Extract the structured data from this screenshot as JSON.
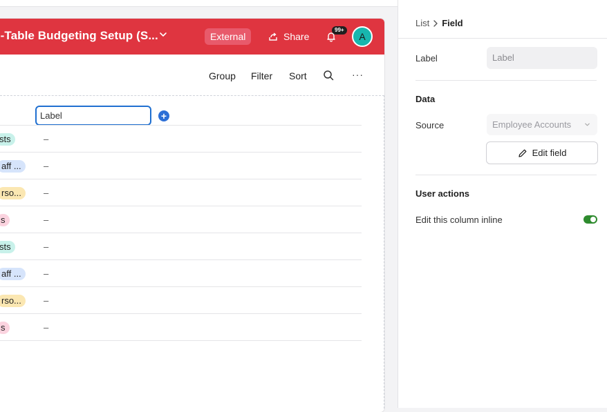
{
  "interface": {
    "title": "ti-Table Budgeting Setup (S...",
    "external_label": "External",
    "share_label": "Share",
    "notification_count": "99+",
    "avatar_initial": "A",
    "colors": {
      "header": "#df3540",
      "accent": "#1f6fd0",
      "toggle_on": "#2e8b2e"
    }
  },
  "toolbar": {
    "group_label": "Group",
    "filter_label": "Filter",
    "sort_label": "Sort",
    "more_label": "···"
  },
  "list": {
    "column_label_value": "Label",
    "rows": [
      {
        "tag": "sts",
        "value": "–",
        "tag_color": "#c8f1ea"
      },
      {
        "tag": "aff ...",
        "value": "–",
        "tag_color": "#d6e4fb"
      },
      {
        "tag": "rso...",
        "value": "–",
        "tag_color": "#fbe7b2"
      },
      {
        "tag": "s",
        "value": "–",
        "tag_color": "#fbd3df"
      },
      {
        "tag": "sts",
        "value": "–",
        "tag_color": "#c8f1ea"
      },
      {
        "tag": "aff ...",
        "value": "–",
        "tag_color": "#d6e4fb"
      },
      {
        "tag": "rso...",
        "value": "–",
        "tag_color": "#fbe7b2"
      },
      {
        "tag": "s",
        "value": "–",
        "tag_color": "#fbd3df"
      }
    ]
  },
  "panel": {
    "breadcrumb": {
      "list": "List",
      "field": "Field"
    },
    "label_caption": "Label",
    "label_placeholder": "Label",
    "data_heading": "Data",
    "source_caption": "Source",
    "source_value": "Employee Accounts",
    "edit_field_label": "Edit field",
    "user_actions_heading": "User actions",
    "inline_edit_caption": "Edit this column inline",
    "inline_edit_enabled": true
  }
}
